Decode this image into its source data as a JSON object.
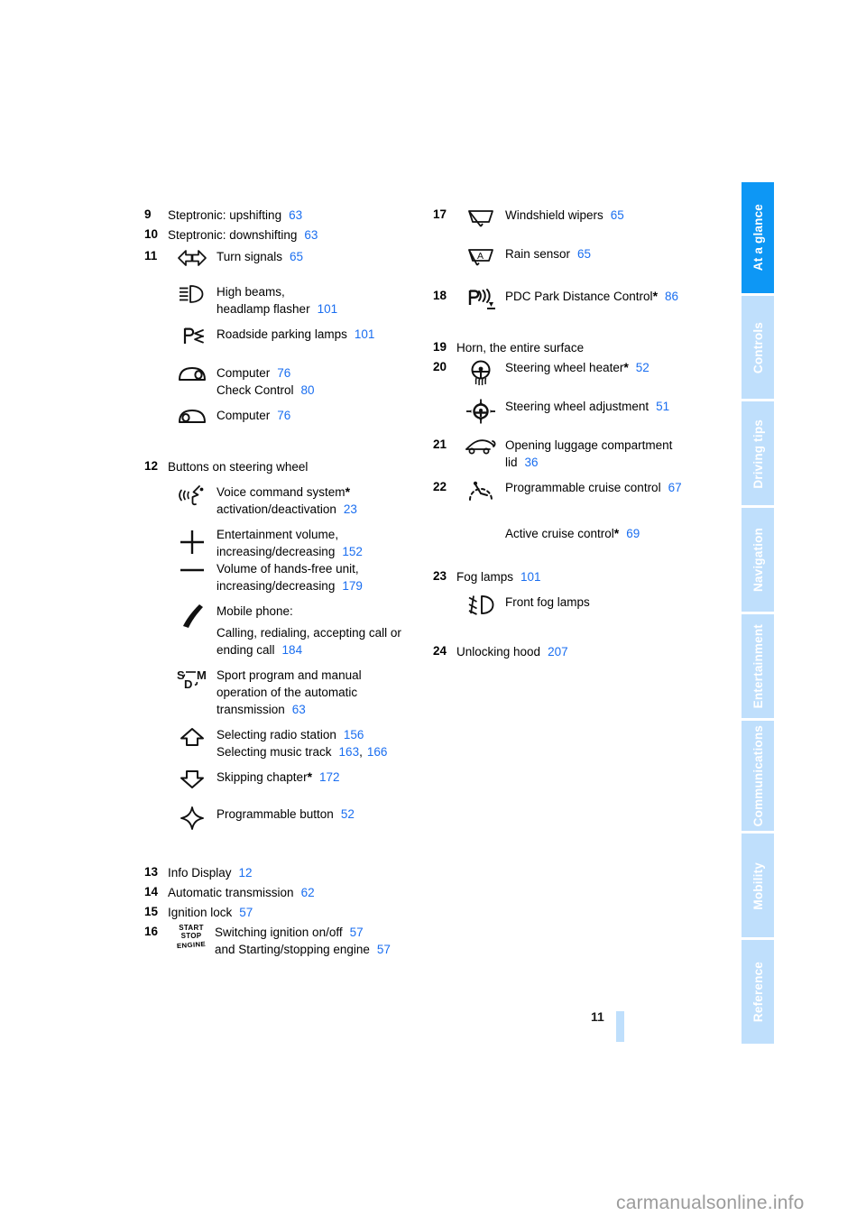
{
  "page_number": "11",
  "watermark": "carmanualsonline.info",
  "colors": {
    "link_blue": "#1a6ef0",
    "tab_active": "#0d97f5",
    "tab_inactive": "#bfdffc"
  },
  "sidebar": {
    "tabs": [
      {
        "label": "At a glance",
        "active": true
      },
      {
        "label": "Controls",
        "active": false
      },
      {
        "label": "Driving tips",
        "active": false
      },
      {
        "label": "Navigation",
        "active": false
      },
      {
        "label": "Entertainment",
        "active": false
      },
      {
        "label": "Communications",
        "active": false
      },
      {
        "label": "Mobility",
        "active": false
      },
      {
        "label": "Reference",
        "active": false
      }
    ]
  },
  "left_column": {
    "item9": {
      "num": "9",
      "text": "Steptronic: upshifting",
      "page": "63"
    },
    "item10": {
      "num": "10",
      "text": "Steptronic: downshifting",
      "page": "63"
    },
    "item11": {
      "num": "11",
      "entries": [
        {
          "icon": "turn-signals-icon",
          "lines": [
            "Turn signals"
          ],
          "page": "65"
        },
        {
          "icon": "high-beams-icon",
          "lines": [
            "High beams,",
            "headlamp flasher"
          ],
          "page": "101"
        },
        {
          "icon": "parking-lamps-icon",
          "lines": [
            "Roadside parking lamps"
          ],
          "page": "101"
        },
        {
          "icon": "stalk-button-computer-icon",
          "line1": "Computer",
          "page1": "76",
          "line2": "Check Control",
          "page2": "80"
        },
        {
          "icon": "stalk-button-computer-alt-icon",
          "lines": [
            "Computer"
          ],
          "page": "76"
        }
      ]
    },
    "item12": {
      "num": "12",
      "heading": "Buttons on steering wheel",
      "entries": [
        {
          "icon": "voice-command-icon",
          "line1": "Voice command system",
          "star": true,
          "line2": "activation/deactivation",
          "page": "23"
        },
        {
          "icon": "volume-plus-minus-icon",
          "line1": "Entertainment volume,",
          "line2": "increasing/decreasing",
          "page1": "152",
          "line3": "Volume of hands-free unit,",
          "line4": "increasing/decreasing",
          "page2": "179"
        },
        {
          "icon": "mobile-phone-icon",
          "line1": "Mobile phone:",
          "line2": "Calling, redialing, accepting call or",
          "line3": "ending call",
          "page": "184"
        },
        {
          "icon": "sport-program-icon",
          "line1": "Sport program and manual",
          "line2": "operation of the automatic",
          "line3": "transmission",
          "page": "63"
        },
        {
          "icon": "arrow-up-icon",
          "line1": "Selecting radio station",
          "page1": "156",
          "line2": "Selecting music track",
          "page2": "163",
          "page3": "166"
        },
        {
          "icon": "arrow-down-icon",
          "line1": "Skipping chapter",
          "star": true,
          "page": "172"
        },
        {
          "icon": "programmable-star-icon",
          "line1": "Programmable button",
          "page": "52"
        }
      ]
    },
    "item13": {
      "num": "13",
      "text": "Info Display",
      "page": "12"
    },
    "item14": {
      "num": "14",
      "text": "Automatic transmission",
      "page": "62"
    },
    "item15": {
      "num": "15",
      "text": "Ignition lock",
      "page": "57"
    },
    "item16": {
      "num": "16",
      "icon": "start-stop-engine-icon",
      "icon_text": {
        "l1": "START",
        "l2": "STOP",
        "l3": "ENGINE"
      },
      "line1": "Switching ignition on/off",
      "page1": "57",
      "line2": "and Starting/stopping engine",
      "page2": "57"
    }
  },
  "right_column": {
    "item17": {
      "num": "17",
      "entries": [
        {
          "icon": "windshield-wipers-icon",
          "line1": "Windshield wipers",
          "page": "65"
        },
        {
          "icon": "rain-sensor-icon",
          "line1": "Rain sensor",
          "page": "65"
        }
      ]
    },
    "item18": {
      "num": "18",
      "icon": "pdc-icon",
      "line1": "PDC Park Distance Control",
      "star": true,
      "page": "86"
    },
    "item19": {
      "num": "19",
      "text": "Horn, the entire surface"
    },
    "item20": {
      "num": "20",
      "entries": [
        {
          "icon": "steering-wheel-heater-icon",
          "line1": "Steering wheel heater",
          "star": true,
          "page": "52"
        },
        {
          "icon": "steering-wheel-adjustment-icon",
          "line1": "Steering wheel adjustment",
          "page": "51"
        }
      ]
    },
    "item21": {
      "num": "21",
      "icon": "luggage-compartment-icon",
      "line1": "Opening luggage compartment",
      "line2": "lid",
      "page": "36"
    },
    "item22": {
      "num": "22",
      "icon": "cruise-control-icon",
      "line1": "Programmable cruise control",
      "page1": "67",
      "line2": "Active cruise control",
      "star": true,
      "page2": "69"
    },
    "item23": {
      "num": "23",
      "text": "Fog lamps",
      "page": "101",
      "icon": "front-fog-lamps-icon",
      "sub": "Front fog lamps"
    },
    "item24": {
      "num": "24",
      "text": "Unlocking hood",
      "page": "207"
    }
  }
}
